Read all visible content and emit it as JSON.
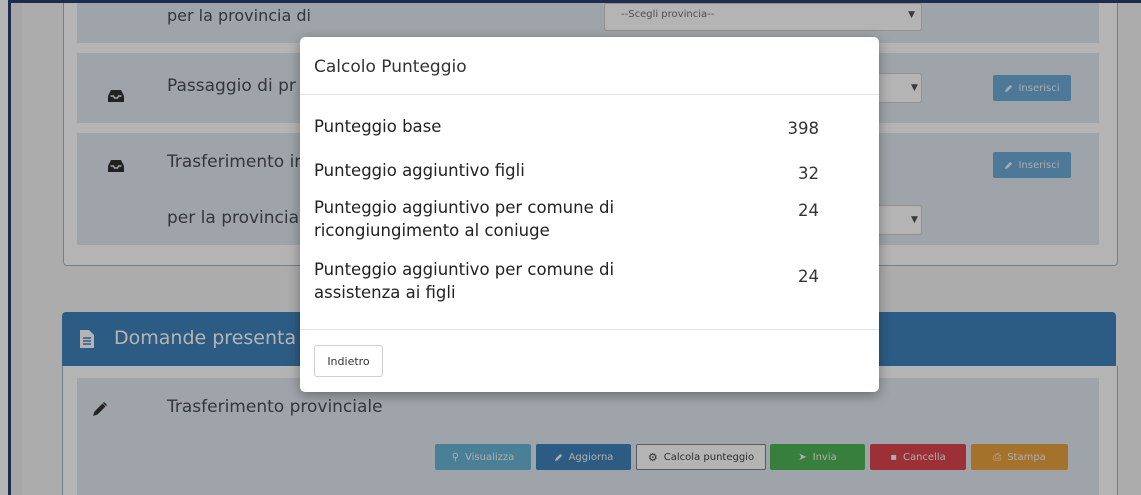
{
  "background_rows": {
    "row0_label": "per la provincia di",
    "row0_select_placeholder": "--Scegli provincia--",
    "row1_label": "Passaggio di pr",
    "row2_label": "Trasferimento in",
    "row2_sublabel": "per la provincia",
    "insert_button_label": "Inserisci"
  },
  "domande_panel": {
    "title": "Domande presenta",
    "item_label": "Trasferimento provinciale",
    "buttons": [
      {
        "label": "Visualizza",
        "color": "#5bb0cf",
        "icon": "search-icon"
      },
      {
        "label": "Aggiorna",
        "color": "#2e79b5",
        "icon": "pencil-icon"
      },
      {
        "label": "Calcola punteggio",
        "color": "#ffffff",
        "icon": "gear-icon"
      },
      {
        "label": "Invia",
        "color": "#3fae49",
        "icon": "arrow-right-icon"
      },
      {
        "label": "Cancella",
        "color": "#d9363e",
        "icon": "trash-icon"
      },
      {
        "label": "Stampa",
        "color": "#e89a2e",
        "icon": "print-icon"
      }
    ]
  },
  "modal": {
    "title": "Calcolo Punteggio",
    "rows": [
      {
        "label": "Punteggio base",
        "value": "398"
      },
      {
        "label": "Punteggio aggiuntivo figli",
        "value": "32"
      },
      {
        "label": "Punteggio aggiuntivo per comune di ricongiungimento al coniuge",
        "value": "24"
      },
      {
        "label": "Punteggio aggiuntivo per comune di assistenza ai figli",
        "value": "24"
      }
    ],
    "back_button": "Indietro"
  }
}
